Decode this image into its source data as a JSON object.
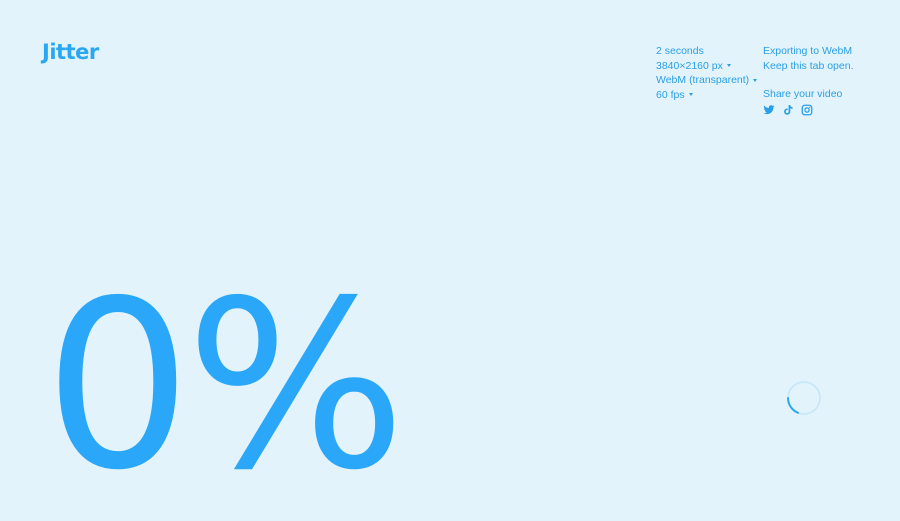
{
  "app": {
    "logo": "Jitter"
  },
  "export_settings": {
    "duration": "2 seconds",
    "resolution": "3840×2160 px",
    "format": "WebM (transparent)",
    "fps": "60 fps"
  },
  "status": {
    "title": "Exporting to WebM",
    "subtitle": "Keep this tab open.",
    "share_label": "Share your video",
    "share_icons": [
      "twitter-icon",
      "tiktok-icon",
      "instagram-icon"
    ]
  },
  "progress": {
    "percent_text": "0%",
    "value": 0
  },
  "colors": {
    "background": "#e2f3fc",
    "accent": "#2aa7f2"
  }
}
